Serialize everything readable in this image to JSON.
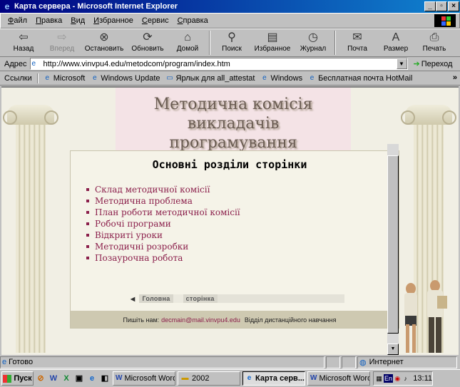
{
  "window": {
    "title": "Карта сервера - Microsoft Internet Explorer",
    "min_icon": "minimize-icon",
    "max_icon": "maximize-icon",
    "close_icon": "close-icon"
  },
  "menu": [
    {
      "label": "Файл",
      "underline": "Ф",
      "rest": "айл"
    },
    {
      "label": "Правка",
      "underline": "П",
      "rest": "равка"
    },
    {
      "label": "Вид",
      "underline": "В",
      "rest": "ид"
    },
    {
      "label": "Избранное",
      "underline": "И",
      "rest": "збранное"
    },
    {
      "label": "Сервис",
      "underline": "С",
      "rest": "ервис"
    },
    {
      "label": "Справка",
      "underline": "С",
      "rest": "правка"
    }
  ],
  "toolbar": {
    "back": "Назад",
    "forward": "Вперед",
    "stop": "Остановить",
    "refresh": "Обновить",
    "home": "Домой",
    "search": "Поиск",
    "favorites": "Избранное",
    "history": "Журнал",
    "mail": "Почта",
    "size": "Размер",
    "print": "Печать"
  },
  "address": {
    "label": "Адрес",
    "url": "http://www.vinvpu4.edu/metodcom/program/index.htm",
    "go": "Переход"
  },
  "links": {
    "label": "Ссылки",
    "items": [
      "Microsoft",
      "Windows Update",
      "Ярлык для all_attestat",
      "Windows",
      "Бесплатная почта HotMail"
    ]
  },
  "page": {
    "title_line1": "Методична комісія",
    "title_line2": "викладачів програмування",
    "heading": "Основні розділи сторінки",
    "sections": [
      "Склад методичної комісії",
      "Методична проблема",
      "План роботи методичної комісії",
      "Робочі програми",
      "Відкриті уроки",
      "Методичні розробки",
      "Позаурочна робота"
    ],
    "nav_home": "Головна",
    "nav_page": "сторінка",
    "footer_label": "Пишіть нам:",
    "footer_email": "decmain@mail.vinvpu4.edu",
    "footer_dept": "Відділ дистанційного навчання"
  },
  "status": {
    "text": "Готово",
    "zone": "Интернет"
  },
  "taskbar": {
    "start": "Пуск",
    "tasks": [
      {
        "label": "Microsoft Word ...",
        "active": false
      },
      {
        "label": "2002",
        "active": false
      },
      {
        "label": "Карта серв...",
        "active": true
      },
      {
        "label": "Microsoft Word ...",
        "active": false
      }
    ],
    "lang": "En",
    "clock": "13:11"
  },
  "colors": {
    "title_bar": "#000080",
    "link_text": "#8b1f4b",
    "page_bg": "#f1efe4",
    "footer_band": "#cec9b1"
  }
}
